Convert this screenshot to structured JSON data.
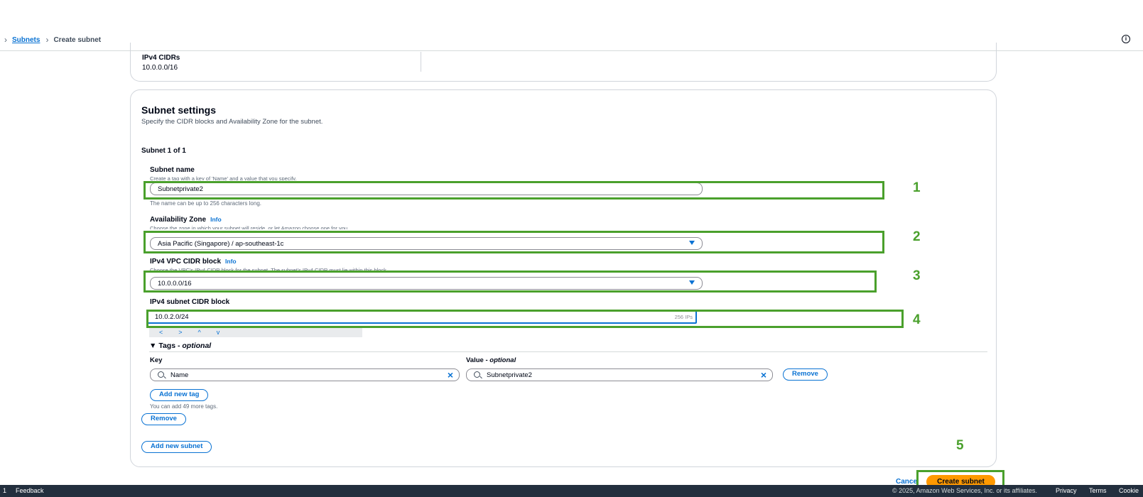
{
  "breadcrumb": {
    "link": "Subnets",
    "current": "Create subnet"
  },
  "vpc_summary": {
    "cidr_label": "IPv4 CIDRs",
    "cidr_value": "10.0.0.0/16"
  },
  "subnet_settings": {
    "title": "Subnet settings",
    "description": "Specify the CIDR blocks and Availability Zone for the subnet.",
    "subnet_count": "Subnet 1 of 1",
    "name": {
      "label": "Subnet name",
      "description": "Create a tag with a key of 'Name' and a value that you specify.",
      "value": "Subnetprivate2",
      "hint": "The name can be up to 256 characters long."
    },
    "az": {
      "label": "Availability Zone",
      "info": "Info",
      "description": "Choose the zone in which your subnet will reside, or let Amazon choose one for you.",
      "value": "Asia Pacific (Singapore) / ap-southeast-1c"
    },
    "vpc_cidr": {
      "label": "IPv4 VPC CIDR block",
      "info": "Info",
      "description": "Choose the VPC's IPv4 CIDR block for the subnet. The subnet's IPv4 CIDR must lie within this block.",
      "value": "10.0.0.0/16"
    },
    "subnet_cidr": {
      "label": "IPv4 subnet CIDR block",
      "value": "10.0.2.0/24",
      "ip_count": "256 IPs",
      "stepper": [
        "<",
        ">",
        "^",
        "v"
      ]
    },
    "tags": {
      "header": "Tags - ",
      "header_optional": "optional",
      "key_label": "Key",
      "value_label": "Value - ",
      "value_optional": "optional",
      "key_value": "Name",
      "value_value": "Subnetprivate2",
      "remove_label": "Remove",
      "add_tag_label": "Add new tag",
      "hint": "You can add 49 more tags."
    },
    "remove_subnet_label": "Remove",
    "add_subnet_label": "Add new subnet"
  },
  "annotations": [
    "1",
    "2",
    "3",
    "4",
    "5"
  ],
  "actions": {
    "cancel_label": "Cance",
    "create_label": "Create subnet"
  },
  "footer": {
    "left_char": "1",
    "feedback": "Feedback",
    "copyright": "© 2025, Amazon Web Services, Inc. or its affiliates.",
    "privacy": "Privacy",
    "terms": "Terms",
    "cookie": "Cookie"
  },
  "colors": {
    "accent": "#0972d3",
    "primary_button": "#ff9900",
    "annotation": "#4aa02c",
    "footer_bg": "#232f3e"
  }
}
